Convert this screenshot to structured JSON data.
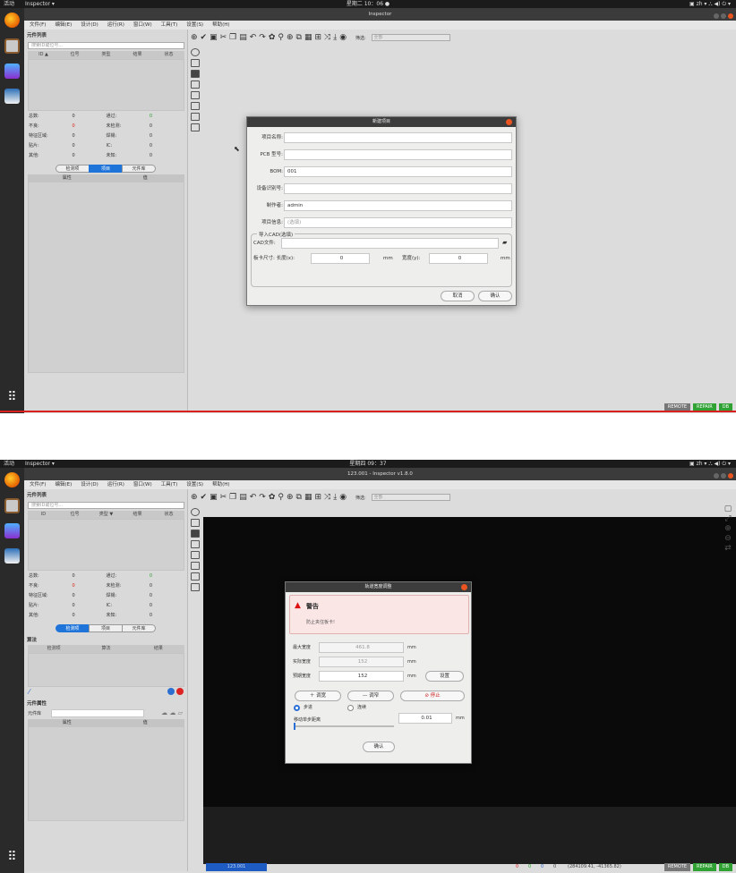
{
  "screenshot1": {
    "topbar": {
      "activities": "活动",
      "app": "Inspector ▾",
      "clock": "星期二 10：06 ●",
      "right": "▣  zh ▾   ⛬ ◀) ⏻ ▾"
    },
    "window_title": "Inspector",
    "menu": [
      "文件(F)",
      "编辑(E)",
      "设计(D)",
      "运行(R)",
      "窗口(W)",
      "工具(T)",
      "设置(S)",
      "帮助(H)"
    ],
    "panel_title": "元件列表",
    "search_placeholder": "搜索ID或位号...",
    "table_headers": [
      "ID ▲",
      "位号",
      "类型",
      "结果",
      "状态"
    ],
    "stats": [
      [
        "总数:",
        "0",
        "通过:",
        "0"
      ],
      [
        "不良:",
        "0",
        "未检测:",
        "0"
      ],
      [
        "特征区域:",
        "0",
        "焊锡:",
        "0"
      ],
      [
        "贴片:",
        "0",
        "IC:",
        "0"
      ],
      [
        "其他:",
        "0",
        "未知:",
        "0"
      ]
    ],
    "tabs": [
      "检测项",
      "项目",
      "元件库"
    ],
    "active_tab": 1,
    "prop_headers": [
      "属性",
      "值"
    ],
    "filter_label": "筛选:",
    "filter_value": "全部",
    "status": [
      "REMOTE",
      "REPAIR",
      "DB"
    ],
    "dialog": {
      "title": "新建项目",
      "fields": [
        {
          "label": "项目名称:",
          "value": ""
        },
        {
          "label": "PCB 型号:",
          "value": ""
        },
        {
          "label": "BOM:",
          "value": "001"
        },
        {
          "label": "设备识别号:",
          "value": ""
        },
        {
          "label": "制作者:",
          "value": "admin"
        },
        {
          "label": "项目信息:",
          "value": "",
          "placeholder": "(选填)"
        }
      ],
      "cad_group": "导入CAD(选填)",
      "cad_file_label": "CAD文件:",
      "board_label": "板卡尺寸: 长度(x):",
      "length": "0",
      "unit1": "mm",
      "width_label": "宽度(y):",
      "width": "0",
      "unit2": "mm",
      "cancel": "取消",
      "ok": "确认"
    }
  },
  "screenshot2": {
    "topbar": {
      "activities": "活动",
      "app": "Inspector ▾",
      "clock": "星期四 09：37",
      "right": "▣  zh ▾   ⛬ ◀) ⏻ ▾"
    },
    "window_title": "123.001 - Inspector v1.8.0",
    "menu": [
      "文件(F)",
      "编辑(E)",
      "设计(D)",
      "运行(R)",
      "窗口(W)",
      "工具(T)",
      "设置(S)",
      "帮助(H)"
    ],
    "panel_title": "元件列表",
    "search_placeholder": "搜索ID或位号...",
    "table_headers": [
      "ID",
      "位号",
      "类型 ▼",
      "结果",
      "状态"
    ],
    "stats": [
      [
        "总数:",
        "0",
        "通过:",
        "0"
      ],
      [
        "不良:",
        "0",
        "未检测:",
        "0"
      ],
      [
        "特征区域:",
        "0",
        "焊锡:",
        "0"
      ],
      [
        "贴片:",
        "0",
        "IC:",
        "0"
      ],
      [
        "其他:",
        "0",
        "未知:",
        "0"
      ]
    ],
    "tabs": [
      "检测项",
      "项目",
      "元件库"
    ],
    "active_tab": 0,
    "algo_title": "算法",
    "algo_headers": [
      "检测项",
      "算法",
      "结果"
    ],
    "prop_title": "元件属性",
    "lib_label": "元件库",
    "prop_headers": [
      "属性",
      "值"
    ],
    "filter_label": "筛选:",
    "filter_value": "全部",
    "status_project": "123.001",
    "status_counts": [
      "0",
      "0",
      "0",
      "0"
    ],
    "coords": "(284109.41, -41365.82)",
    "status": [
      "REMOTE",
      "REPAIR",
      "DB"
    ],
    "dialog": {
      "title": "轨道宽度调整",
      "warn_title": "警告",
      "warn_text": "防止夹住板卡!",
      "rows": [
        {
          "label": "最大宽度",
          "value": "461.8",
          "unit": "mm"
        },
        {
          "label": "实际宽度",
          "value": "152",
          "unit": "mm"
        },
        {
          "label": "预期宽度",
          "value": "152",
          "unit": "mm",
          "button": "设置"
        }
      ],
      "widen": "＋ 调宽",
      "narrow": "— 调窄",
      "stop": "⊘ 停止",
      "step": "步进",
      "continuous": "连续",
      "move_label": "移动单步距离",
      "move_value": "0.01",
      "move_unit": "mm",
      "ok": "确认"
    }
  }
}
